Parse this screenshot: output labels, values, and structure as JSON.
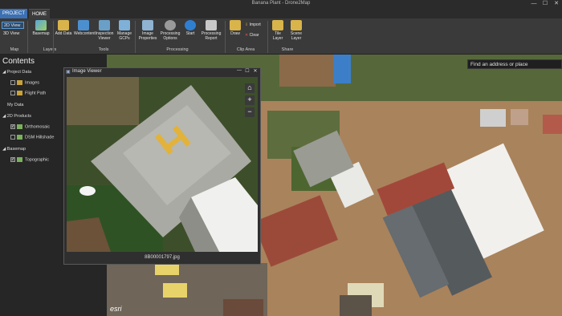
{
  "window": {
    "title": "Banana Plant - Drone2Map",
    "controls": [
      "—",
      "☐",
      "✕"
    ]
  },
  "tabs": [
    {
      "label": "PROJECT"
    },
    {
      "label": "HOME"
    }
  ],
  "ribbon": {
    "map_group": {
      "view2d": "2D View",
      "view3d": "3D View",
      "label": "Map"
    },
    "layers_group": {
      "basemap": "Basemap",
      "label": "Layers"
    },
    "tools_group": {
      "add_data": "Add Data",
      "webcontent": "Webcontent",
      "inspection_viewer": "Inspection Viewer",
      "manage_gcps": "Manage GCPs",
      "label": "Tools"
    },
    "processing_group": {
      "image_properties": "Image Properties",
      "processing_options": "Processing Options",
      "start": "Start",
      "processing_report": "Processing Report",
      "label": "Processing"
    },
    "clip_group": {
      "draw": "Draw",
      "import": "Import",
      "clear": "Clear",
      "label": "Clip Area"
    },
    "share_group": {
      "tile_layer": "Tile Layer",
      "scene_layer": "Scene Layer",
      "label": "Share"
    }
  },
  "contents": {
    "title": "Contents",
    "groups": [
      {
        "name": "Project Data",
        "items": [
          {
            "label": "Images",
            "checked": false
          },
          {
            "label": "Flight Path",
            "checked": false
          }
        ]
      },
      {
        "name": "My Data",
        "items": []
      },
      {
        "name": "2D Products",
        "items": [
          {
            "label": "Orthomosaic",
            "checked": true
          },
          {
            "label": "DSM Hillshade",
            "checked": false
          }
        ]
      },
      {
        "name": "Basemap",
        "items": [
          {
            "label": "Topographic",
            "checked": true
          }
        ]
      }
    ]
  },
  "search": {
    "placeholder": "Find an address or place"
  },
  "image_viewer": {
    "title": "Image Viewer",
    "filename": "8B00001797.jpg",
    "zoom_in": "+",
    "zoom_out": "−"
  },
  "attribution": "esri",
  "colors": {
    "accent": "#3b70b3",
    "ribbon": "#3a3a3a",
    "pane": "#262626",
    "titlebar": "#2b2b2b"
  }
}
